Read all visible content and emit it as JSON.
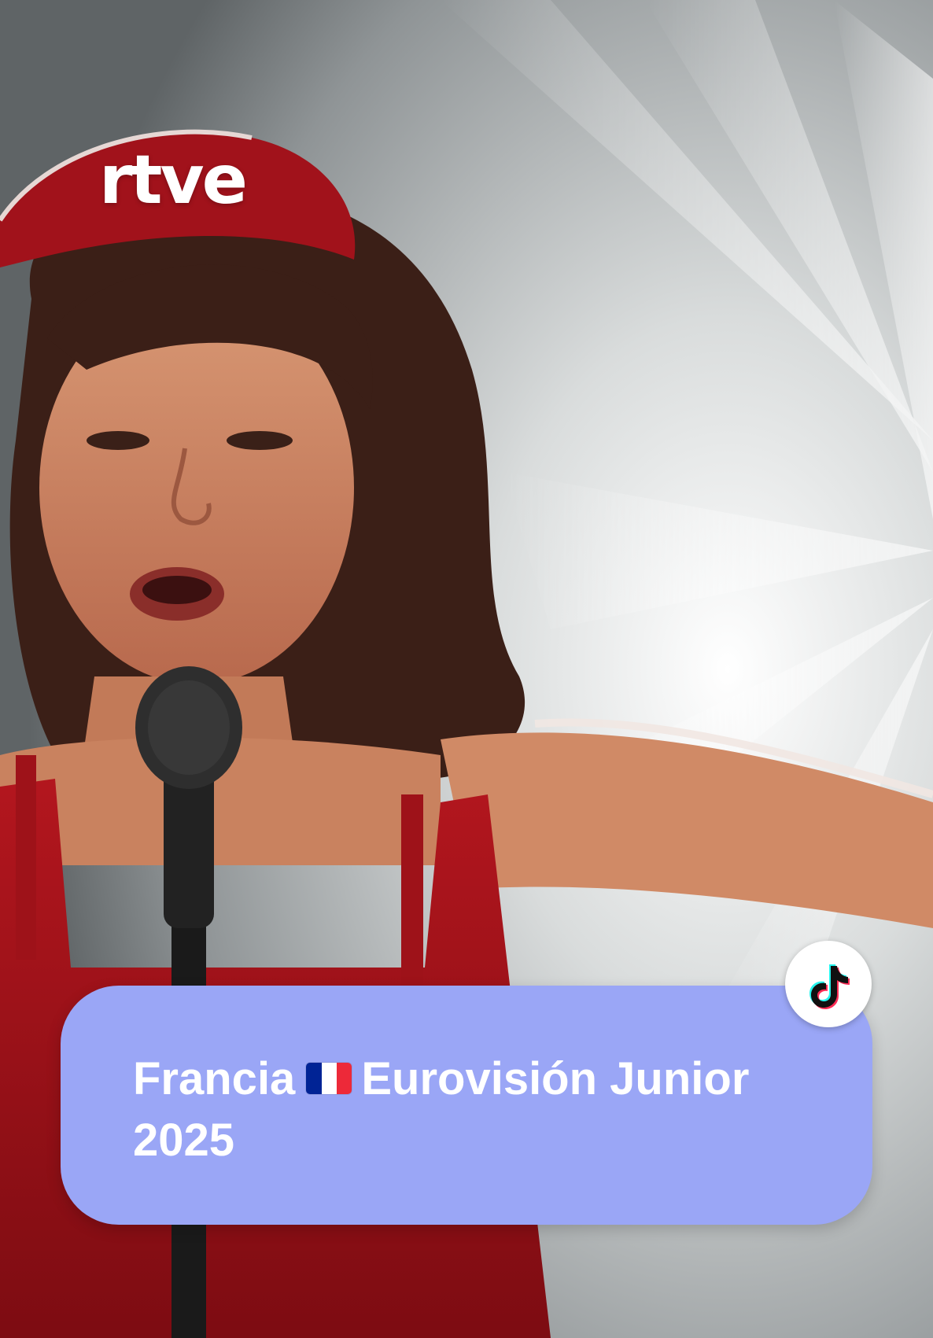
{
  "logo": {
    "text": "rtve"
  },
  "caption": {
    "country": "Francia",
    "flag_icon": "flag-france-icon",
    "flag_colors": [
      "#002395",
      "#ffffff",
      "#ed2939"
    ],
    "title_line1": "Eurovisión Junior",
    "title_line2": "2025"
  },
  "badge": {
    "icon": "tiktok-icon"
  },
  "colors": {
    "caption_background": "#9aa6f6",
    "text": "#ffffff",
    "dress_red": "#b3161e"
  }
}
